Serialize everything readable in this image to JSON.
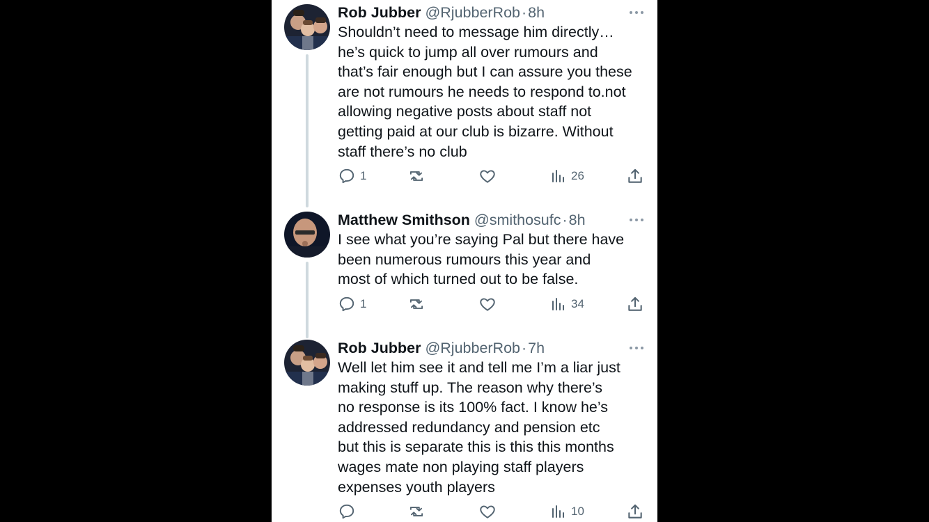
{
  "tweets": [
    {
      "name": "Rob Jubber",
      "handle": "@RjubberRob",
      "dot": "·",
      "time": "8h",
      "text": "Shouldn’t need to message him directly…\nhe’s quick to jump all over rumours and\nthat’s fair enough but I can assure you these\nare not rumours he needs to respond to.not\nallowing negative posts about staff not\ngetting paid at our club is bizarre. Without\nstaff there’s no club",
      "reply_count": "1",
      "retweet_count": "",
      "like_count": "",
      "view_count": "26"
    },
    {
      "name": "Matthew Smithson",
      "handle": "@smithosufc",
      "dot": "·",
      "time": "8h",
      "text": "I see what you’re saying Pal but there have\nbeen numerous rumours this year and\nmost of which turned out to be false.",
      "reply_count": "1",
      "retweet_count": "",
      "like_count": "",
      "view_count": "34"
    },
    {
      "name": "Rob Jubber",
      "handle": "@RjubberRob",
      "dot": "·",
      "time": "7h",
      "text": "Well let him see it and tell me I’m a liar just\nmaking stuff up.  The reason why there’s\nno response is its 100% fact. I know he’s\naddressed redundancy and pension etc\nbut this is separate this is this this months\nwages mate non playing staff players\nexpenses youth players",
      "reply_count": "",
      "retweet_count": "",
      "like_count": "",
      "view_count": "10"
    }
  ],
  "icons": {
    "reply": "reply-icon",
    "retweet": "retweet-icon",
    "like": "like-icon",
    "views": "views-icon",
    "share": "share-icon",
    "more": "more-icon"
  },
  "colors": {
    "text": "#0f1419",
    "secondary": "#536471",
    "thread_line": "#cfd9de"
  }
}
